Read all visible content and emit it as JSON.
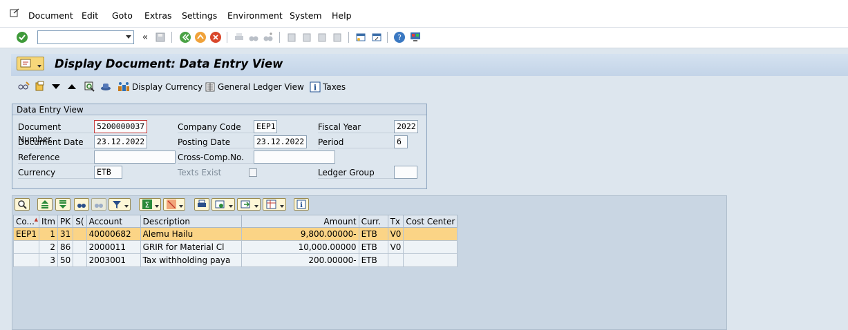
{
  "menu": {
    "items": [
      "Document",
      "Edit",
      "Goto",
      "Extras",
      "Settings",
      "Environment",
      "System",
      "Help"
    ]
  },
  "toolbar": {
    "command_field_value": ""
  },
  "title": {
    "text": "Display Document: Data Entry View"
  },
  "app_toolbar": {
    "display_currency": "Display Currency",
    "general_ledger_view": "General Ledger View",
    "taxes": "Taxes"
  },
  "header": {
    "group_title": "Data Entry View",
    "fields": {
      "document_number": {
        "label": "Document Number",
        "value": "5200000037"
      },
      "company_code": {
        "label": "Company Code",
        "value": "EEP1"
      },
      "fiscal_year": {
        "label": "Fiscal Year",
        "value": "2022"
      },
      "document_date": {
        "label": "Document Date",
        "value": "23.12.2022"
      },
      "posting_date": {
        "label": "Posting Date",
        "value": "23.12.2022"
      },
      "period": {
        "label": "Period",
        "value": "6"
      },
      "reference": {
        "label": "Reference",
        "value": ""
      },
      "cross_comp": {
        "label": "Cross-Comp.No.",
        "value": ""
      },
      "currency": {
        "label": "Currency",
        "value": "ETB"
      },
      "texts_exist": {
        "label": "Texts Exist",
        "checked": false
      },
      "ledger_group": {
        "label": "Ledger Group",
        "value": ""
      }
    }
  },
  "grid": {
    "columns": [
      "Co...",
      "Itm",
      "PK",
      "S(",
      "Account",
      "Description",
      "Amount",
      "Curr.",
      "Tx",
      "Cost Center"
    ],
    "rows": [
      {
        "co": "EEP1",
        "itm": "1",
        "pk": "31",
        "s": "",
        "account": "40000682",
        "description": "Alemu Hailu",
        "amount": "9,800.00000-",
        "curr": "ETB",
        "tx": "V0",
        "cost_center": ""
      },
      {
        "co": "",
        "itm": "2",
        "pk": "86",
        "s": "",
        "account": "2000011",
        "description": "GRIR for Material Cl",
        "amount": "10,000.00000",
        "curr": "ETB",
        "tx": "V0",
        "cost_center": ""
      },
      {
        "co": "",
        "itm": "3",
        "pk": "50",
        "s": "",
        "account": "2003001",
        "description": "Tax withholding paya",
        "amount": "200.00000-",
        "curr": "ETB",
        "tx": "",
        "cost_center": ""
      }
    ]
  },
  "colors": {
    "selected_row": "#fbd486",
    "title_bar": "#c3d4e8",
    "background": "#dde6ee"
  }
}
